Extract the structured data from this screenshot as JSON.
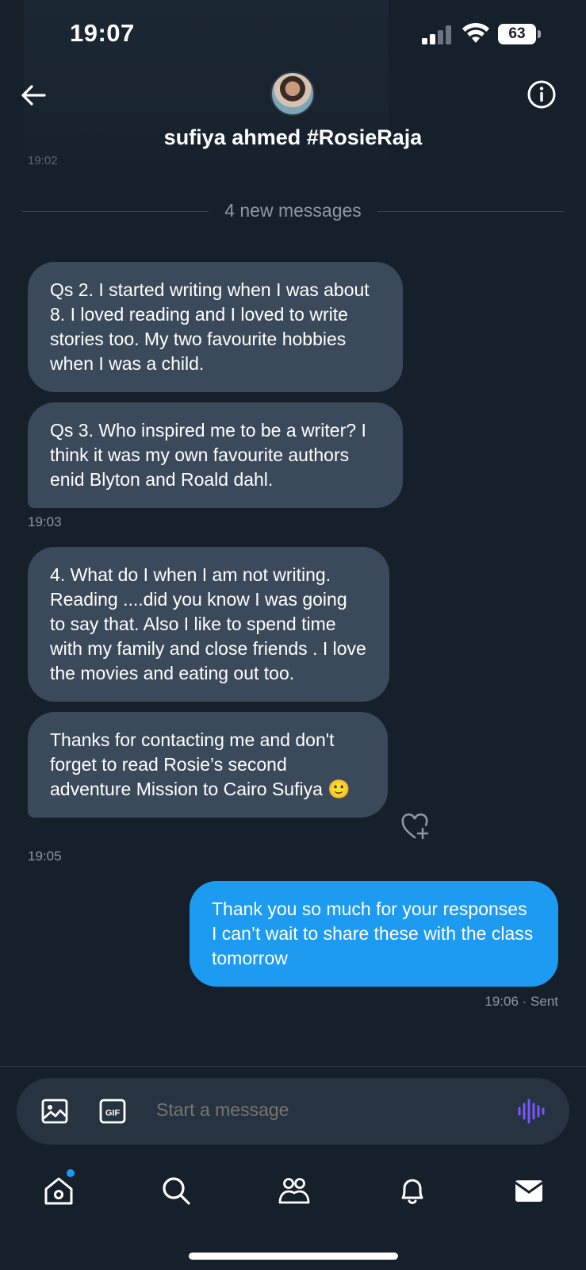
{
  "status_bar": {
    "time": "19:07",
    "battery": "63"
  },
  "header": {
    "contact_name": "sufiya ahmed #RosieRaja",
    "cut_timestamp": "19:02"
  },
  "divider": {
    "label": "4 new messages"
  },
  "messages": [
    {
      "direction": "in",
      "text": "Qs 2. I started writing when I was about 8. I loved reading and I loved to write stories too. My two favourite hobbies when I was a child."
    },
    {
      "direction": "in",
      "text": "Qs 3. Who inspired me to be a writer? I think it was my own favourite authors enid Blyton and Roald dahl."
    },
    {
      "direction": "in",
      "text": "4. What do I when I am not writing. Reading ....did you know I was going to say that. Also I like to spend time with my family and close friends  . I love the movies and eating out too."
    },
    {
      "direction": "in",
      "text": "Thanks for contacting me and don't forget to read Rosie’s second adventure Mission to Cairo Sufiya 🙂"
    },
    {
      "direction": "out",
      "text": "Thank you so much for your responses I can’t wait to share these with the class tomorrow"
    }
  ],
  "timestamps": {
    "after_msg2": "19:03",
    "after_msg4": "19:05",
    "after_msg5": "19:06 · Sent"
  },
  "composer": {
    "placeholder": "Start a message"
  },
  "colors": {
    "background": "#15202b",
    "incoming_bubble": "#3b4a5a",
    "outgoing_bubble": "#1d9bf0",
    "muted_text": "#8b98a5",
    "voice_accent": "#7856ff"
  },
  "icons": {
    "back": "arrow-left-icon",
    "info": "info-icon",
    "react": "heart-plus-icon",
    "image": "image-icon",
    "gif": "gif-icon",
    "voice": "voice-wave-icon",
    "tabs": [
      "home-icon",
      "search-icon",
      "communities-icon",
      "bell-icon",
      "mail-icon"
    ]
  }
}
